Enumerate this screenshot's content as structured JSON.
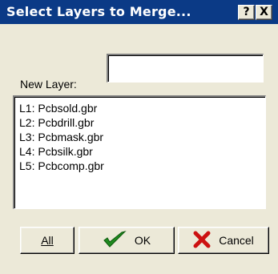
{
  "window": {
    "title": "Select Layers to Merge...",
    "help_label": "?",
    "close_label": "X"
  },
  "new_layer": {
    "label": "New Layer:",
    "value": ""
  },
  "layers": {
    "items": [
      {
        "label": "L1: Pcbsold.gbr"
      },
      {
        "label": "L2: Pcbdrill.gbr"
      },
      {
        "label": "L3: Pcbmask.gbr"
      },
      {
        "label": "L4: Pcbsilk.gbr"
      },
      {
        "label": "L5: Pcbcomp.gbr"
      }
    ]
  },
  "buttons": {
    "all_label": "All",
    "ok_label": "OK",
    "cancel_label": "Cancel",
    "ok_icon": "checkmark-icon",
    "cancel_icon": "red-x-icon",
    "ok_icon_color": "#1f8a1f",
    "cancel_icon_color": "#cc1111"
  },
  "colors": {
    "titlebar": "#0b3a86",
    "dialog_bg": "#ece9d8"
  }
}
